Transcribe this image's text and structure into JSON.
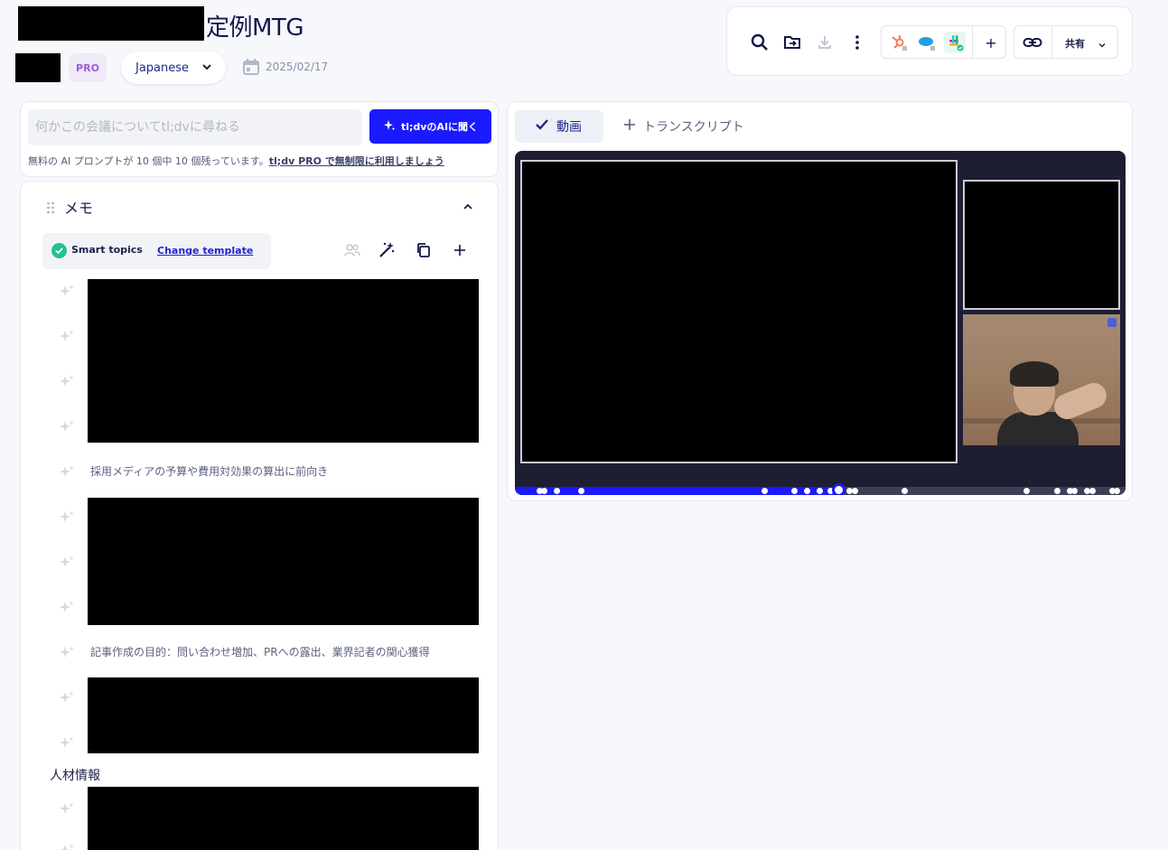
{
  "header": {
    "title": "定例MTG",
    "badge": "PRO",
    "language": "Japanese",
    "date": "2025/02/17"
  },
  "toolbar": {
    "icons": [
      "search-icon",
      "folder-move-icon",
      "download-icon",
      "more-icon"
    ],
    "integrations": [
      "hubspot-icon",
      "salesforce-icon",
      "slack-icon"
    ],
    "add_label": "+",
    "share_label": "共有"
  },
  "ai": {
    "placeholder": "何かこの会議についてtl;dvに尋ねる",
    "button_label": "tl;dvのAIに聞く",
    "note_prefix": "無料の AI プロンプトが 10 個中 10 個残っています。",
    "note_link": "tl;dv PRO で無制限に利用しましょう"
  },
  "memo": {
    "title": "メモ",
    "topics_label": "Smart topics",
    "change_template": "Change template",
    "items": [
      "採用メディアの予算や費用対効果の算出に前向き",
      "記事作成の目的：問い合わせ増加、PRへの露出、業界記者の関心獲得"
    ],
    "section_heading": "人材情報"
  },
  "video": {
    "tabs": [
      {
        "label": "動画",
        "active": true
      },
      {
        "label": "トランスクリプト",
        "active": false
      }
    ],
    "progress": 0.53
  },
  "colors": {
    "accent": "#1a1aff",
    "badge_text": "#9b5fd0",
    "success": "#21c28e"
  }
}
